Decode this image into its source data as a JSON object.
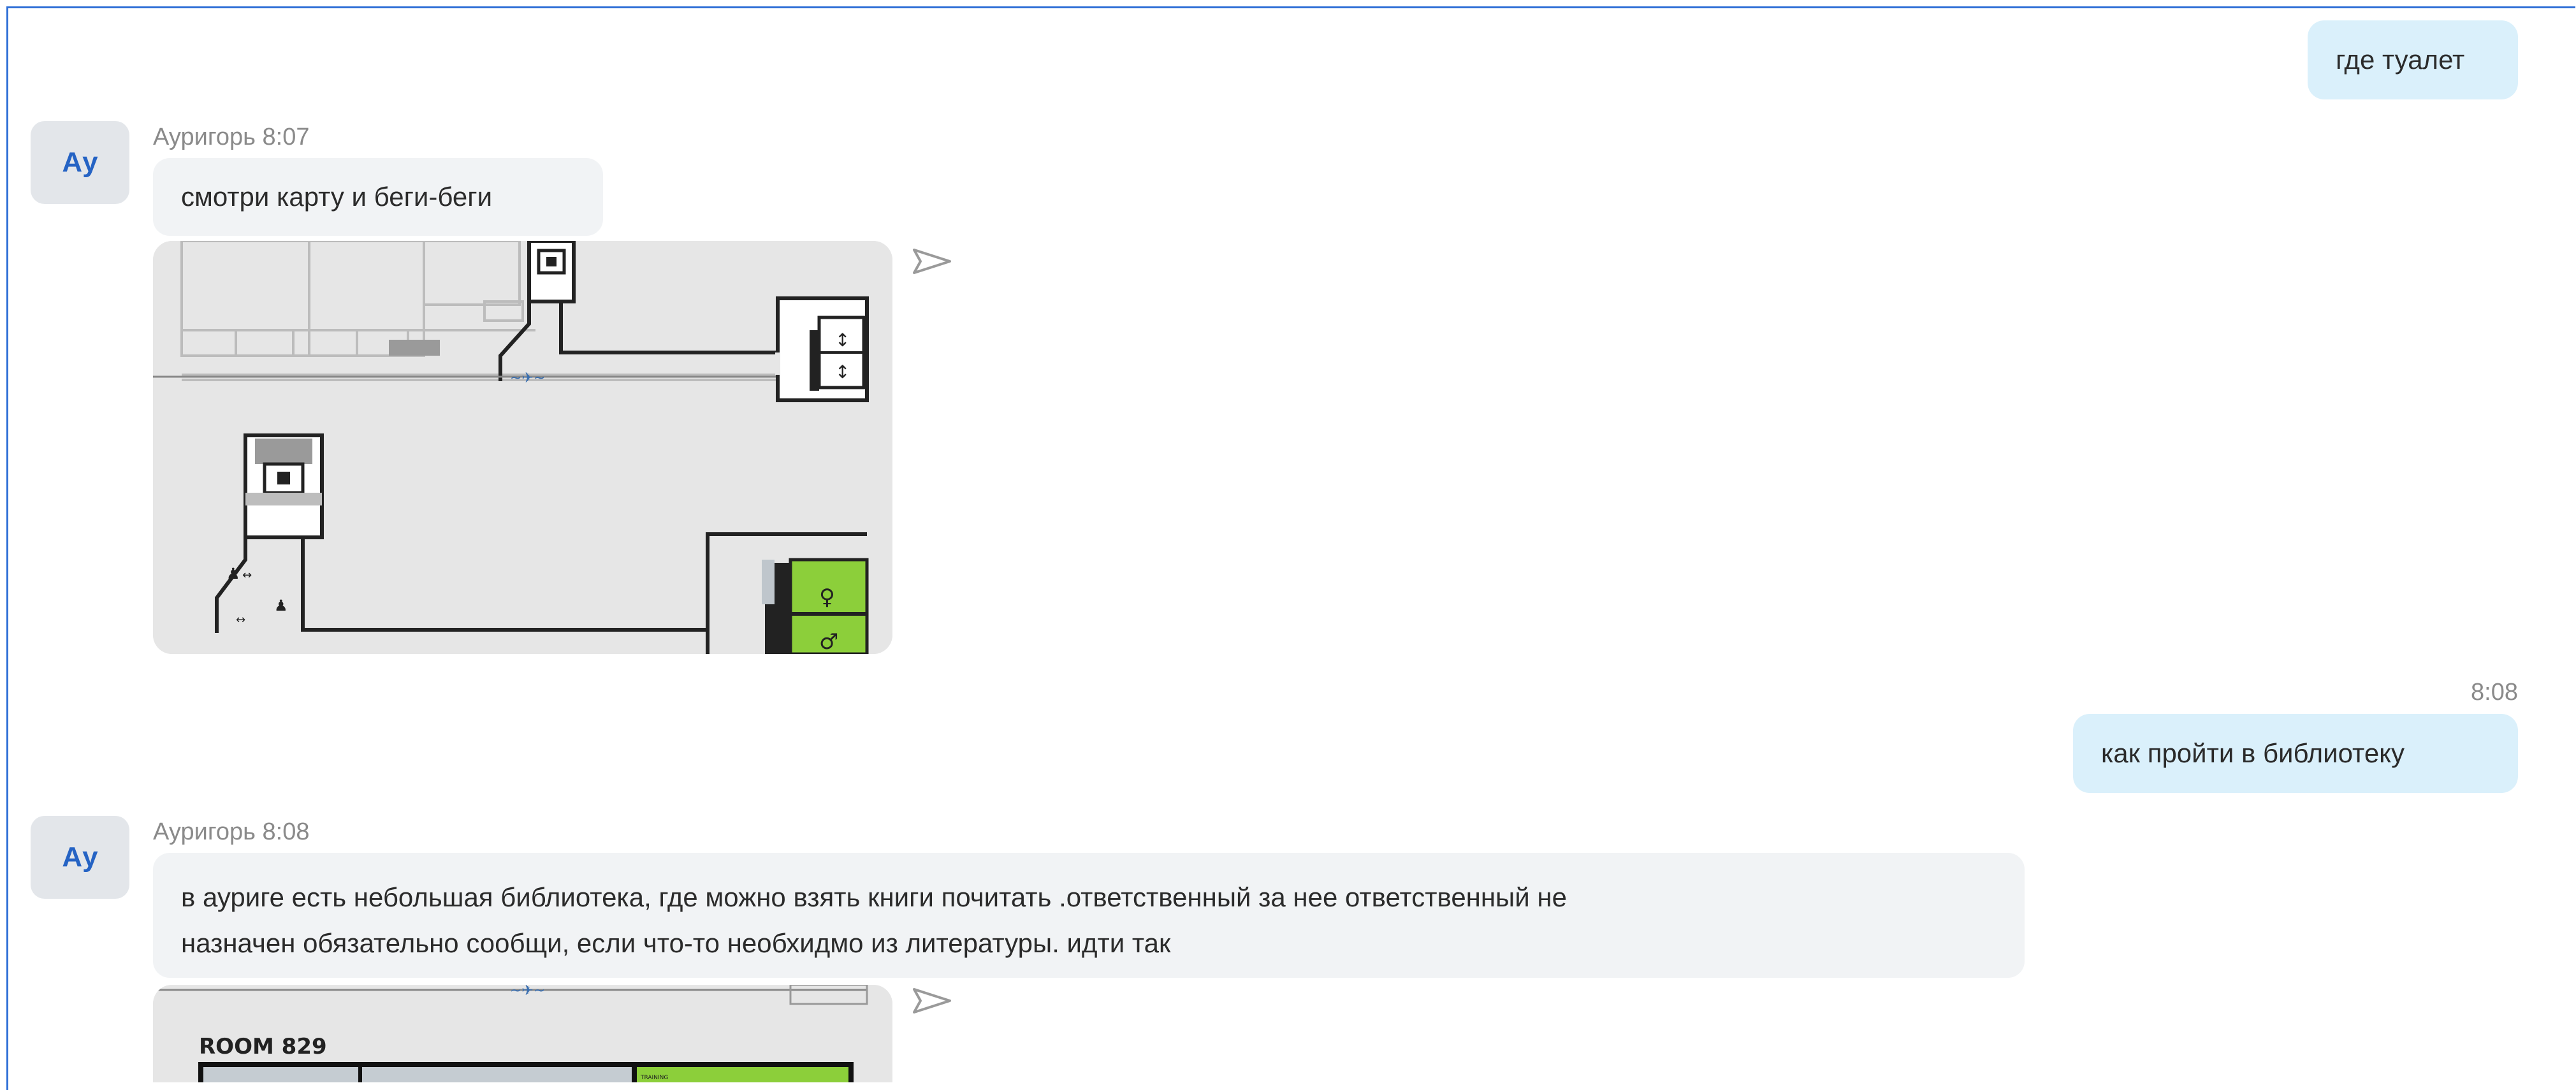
{
  "messages": [
    {
      "type": "out",
      "text": "где туалет"
    },
    {
      "type": "in",
      "avatar": "Ау",
      "author": "Ауригорь",
      "time": "8:07",
      "text": "смотри карту и беги-беги",
      "attachment": "map-image"
    },
    {
      "type": "out",
      "time": "8:08",
      "text": "как пройти в библиотеку"
    },
    {
      "type": "in",
      "avatar": "Ау",
      "author": "Ауригорь",
      "time": "8:08",
      "lines": [
        "в ауриге есть небольшая библиотека, где можно взять книги почитать .ответственный за нее ответственный не",
        "назначен обязательно сообщи, если что-то необхидмо из литературы. идти так"
      ],
      "attachment": "map-image"
    }
  ],
  "map2": {
    "room_label": "ROOM 829",
    "training_label": "TRAINING"
  },
  "icons": {
    "send": "paper-plane-icon"
  },
  "colors": {
    "accent": "#2563c4",
    "out_bubble": "#daf0fb",
    "in_bubble": "#f1f3f5",
    "map_green": "#8ccf3a"
  }
}
